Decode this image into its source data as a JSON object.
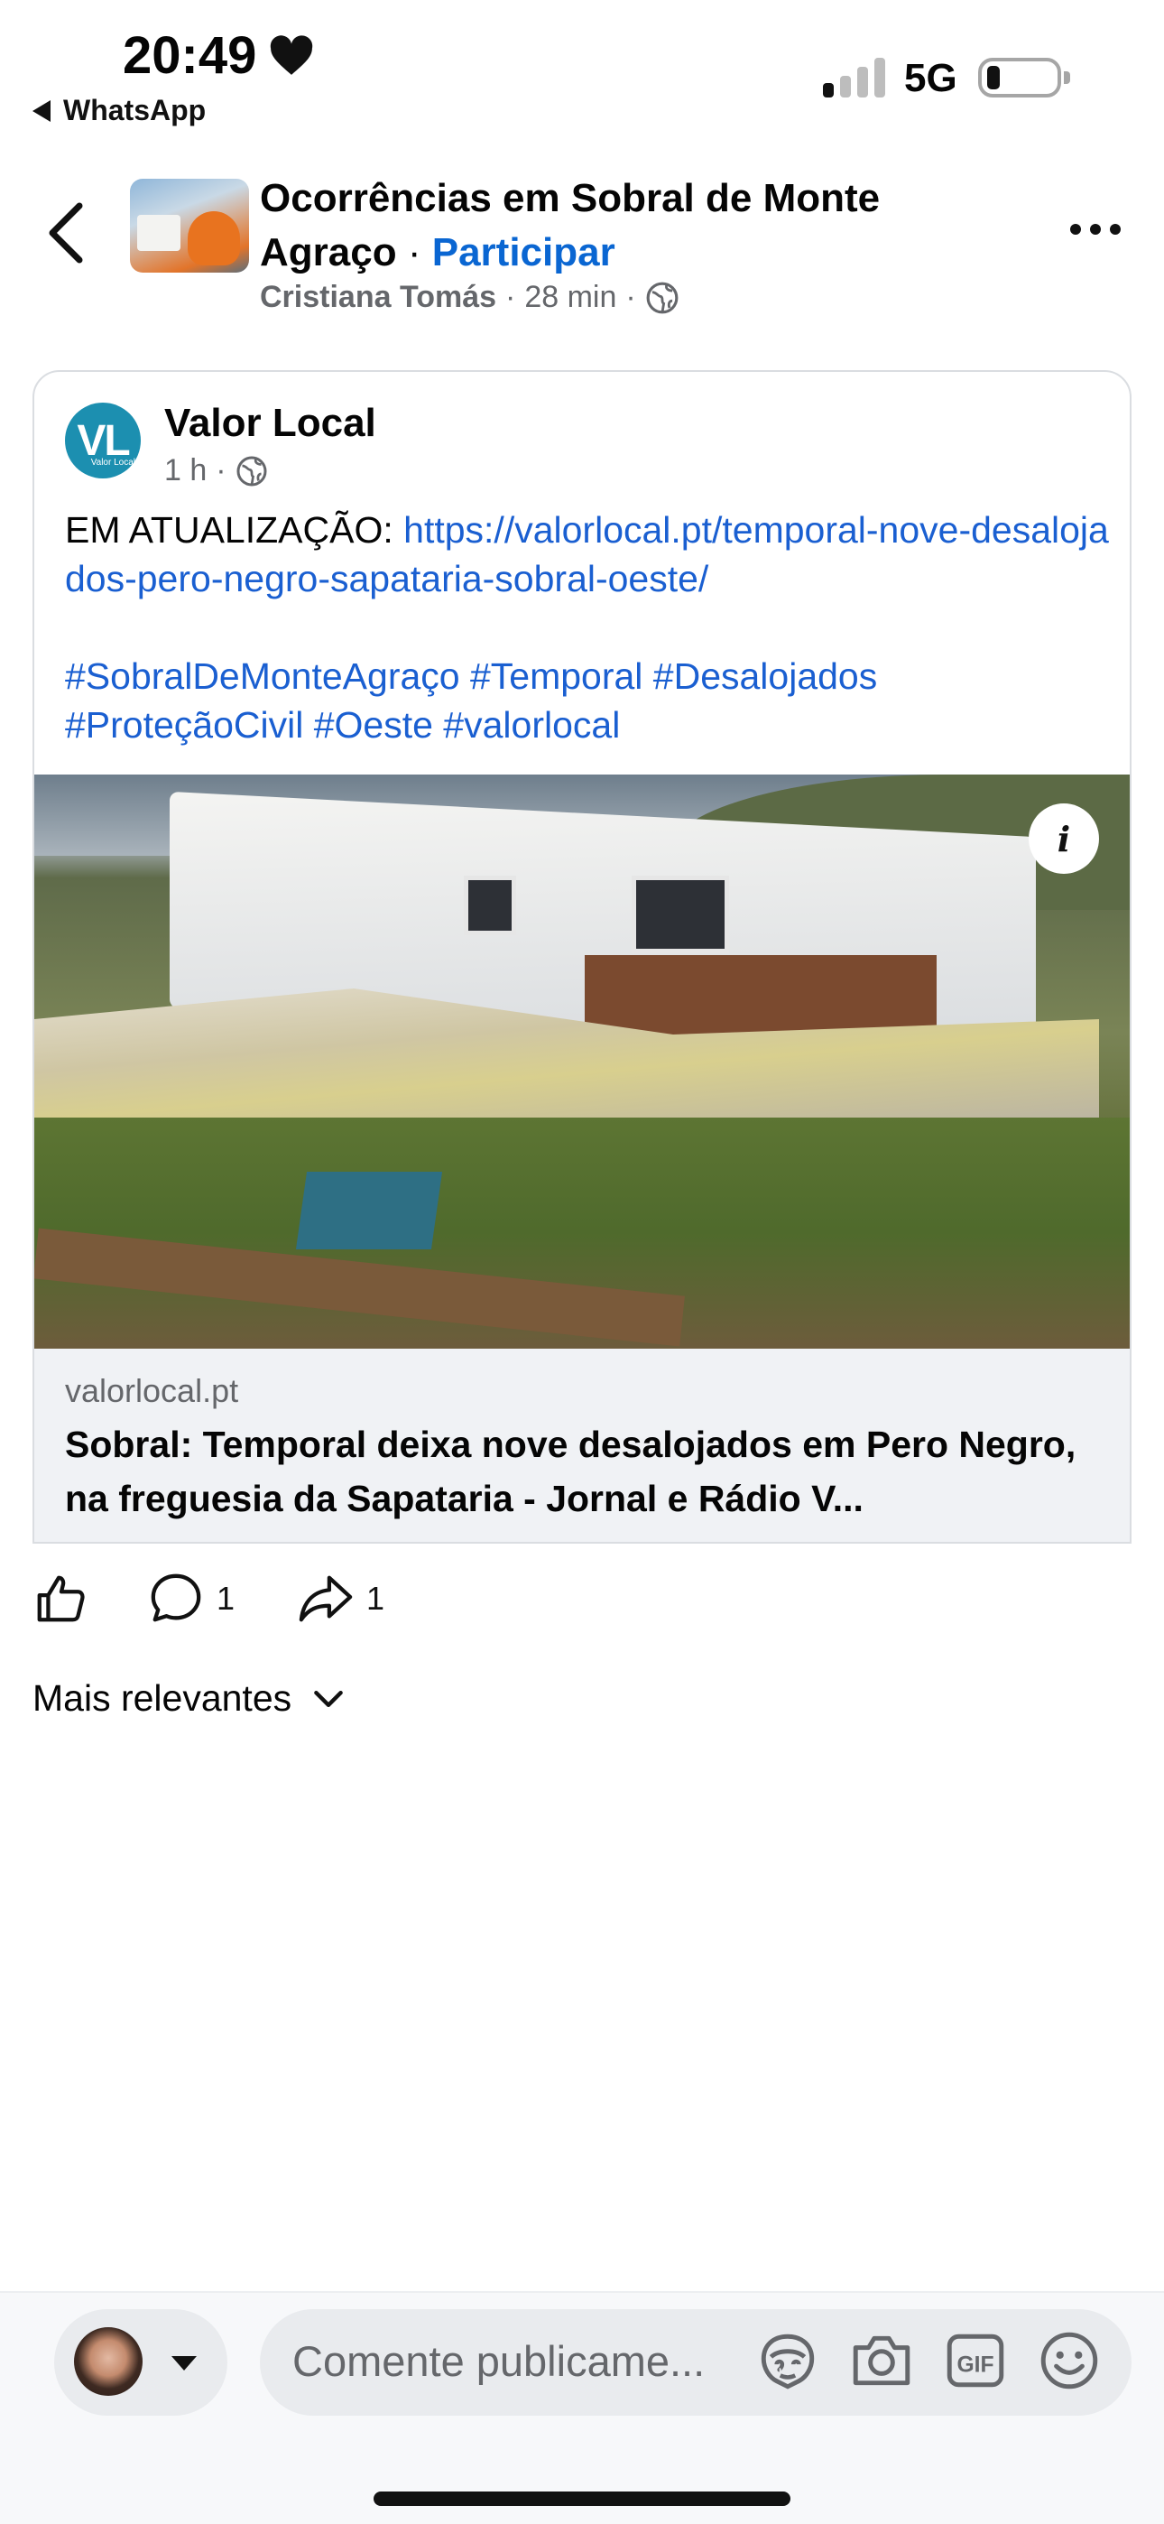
{
  "status": {
    "time": "20:49",
    "back_app": "WhatsApp",
    "network": "5G"
  },
  "group": {
    "title": "Ocorrências em Sobral de Monte Agraço",
    "dot": "·",
    "join_label": "Participar",
    "author": "Cristiana Tomás",
    "time": "28 min"
  },
  "post": {
    "page_name": "Valor Local",
    "logo_text": "VL",
    "logo_small": "Valor Local",
    "time": "1 h",
    "text_prefix": "EM ATUALIZAÇÃO: ",
    "link": "https://valorlocal.pt/temporal-nove-desalojados-pero-negro-sapataria-sobral-oeste/",
    "hashtags": "#SobralDeMonteAgraço #Temporal #Desalojados #ProteçãoCivil #Oeste #valorlocal",
    "info_glyph": "i",
    "preview_domain": "valorlocal.pt",
    "preview_title": "Sobral: Temporal deixa nove desalojados em Pero Negro, na freguesia da Sapataria - Jornal e Rádio V..."
  },
  "actions": {
    "comments_count": "1",
    "shares_count": "1"
  },
  "sort_label": "Mais relevantes",
  "composer": {
    "placeholder": "Comente publicame..."
  },
  "colors": {
    "accent_blue": "#0a66d2",
    "link_blue": "#1a5fd1",
    "secondary_text": "#65676b",
    "valor_local_brand": "#1c8fb0"
  },
  "icons": [
    "heart-icon",
    "chevron-left-icon",
    "more-icon",
    "globe-icon",
    "info-icon",
    "like-icon",
    "comment-icon",
    "share-icon",
    "chevron-down-icon",
    "avatar-sticker-icon",
    "camera-icon",
    "gif-icon",
    "emoji-icon"
  ]
}
